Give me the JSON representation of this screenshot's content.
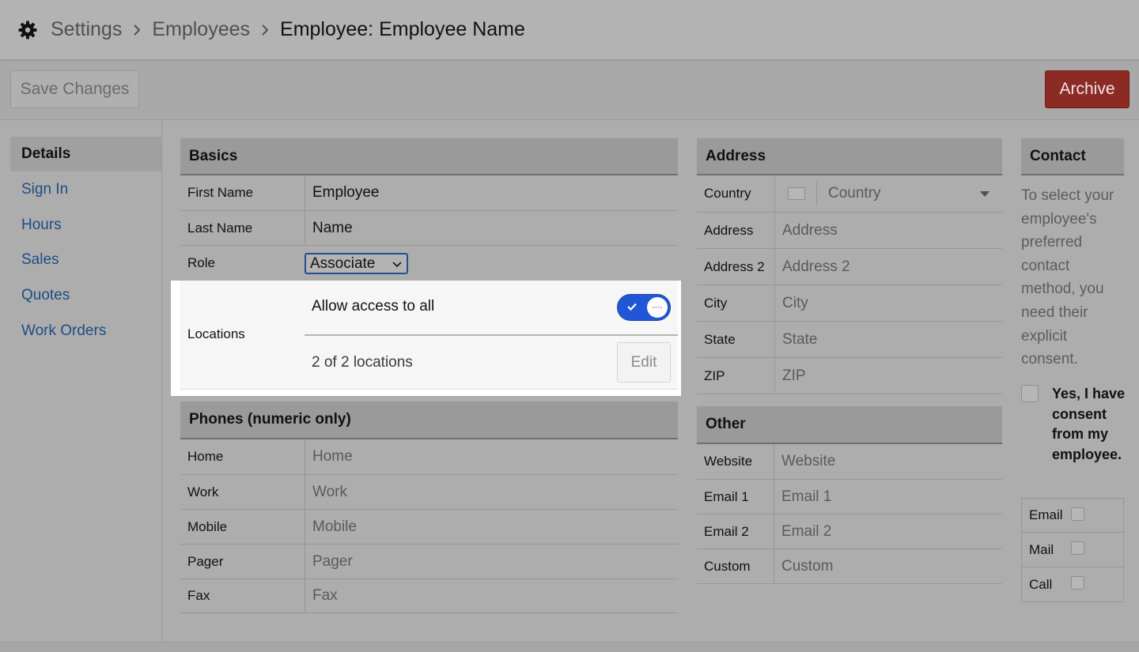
{
  "breadcrumb": {
    "items": [
      "Settings",
      "Employees"
    ],
    "current": "Employee: Employee Name",
    "icon": "gear-icon"
  },
  "toolbar": {
    "save_label": "Save Changes",
    "archive_label": "Archive",
    "archive_color": "#8c2a24"
  },
  "sidebar": {
    "items": [
      {
        "label": "Details",
        "active": true
      },
      {
        "label": "Sign In"
      },
      {
        "label": "Hours"
      },
      {
        "label": "Sales"
      },
      {
        "label": "Quotes"
      },
      {
        "label": "Work Orders"
      }
    ],
    "link_color": "#1d4d86"
  },
  "basics": {
    "title": "Basics",
    "first_name_label": "First Name",
    "first_name_value": "Employee",
    "last_name_label": "Last Name",
    "last_name_value": "Name",
    "role_label": "Role",
    "role_value": "Associate",
    "locations_label": "Locations",
    "allow_all_label": "Allow access to all",
    "allow_all_on": true,
    "locations_count": "2 of 2 locations",
    "edit_label": "Edit",
    "toggle_color": "#2157d6"
  },
  "phones": {
    "title": "Phones (numeric only)",
    "fields": [
      {
        "label": "Home",
        "placeholder": "Home"
      },
      {
        "label": "Work",
        "placeholder": "Work"
      },
      {
        "label": "Mobile",
        "placeholder": "Mobile"
      },
      {
        "label": "Pager",
        "placeholder": "Pager"
      },
      {
        "label": "Fax",
        "placeholder": "Fax"
      }
    ]
  },
  "address": {
    "title": "Address",
    "country_label": "Country",
    "country_placeholder": "Country",
    "fields": [
      {
        "label": "Address",
        "placeholder": "Address"
      },
      {
        "label": "Address 2",
        "placeholder": "Address 2"
      },
      {
        "label": "City",
        "placeholder": "City"
      },
      {
        "label": "State",
        "placeholder": "State"
      },
      {
        "label": "ZIP",
        "placeholder": "ZIP"
      }
    ]
  },
  "other": {
    "title": "Other",
    "fields": [
      {
        "label": "Website",
        "placeholder": "Website"
      },
      {
        "label": "Email 1",
        "placeholder": "Email 1"
      },
      {
        "label": "Email 2",
        "placeholder": "Email 2"
      },
      {
        "label": "Custom",
        "placeholder": "Custom"
      }
    ]
  },
  "contact": {
    "title": "Contact",
    "description": "To select your employee's preferred contact method, you need their explicit consent.",
    "consent_label": "Yes, I have consent from my employee.",
    "methods": [
      {
        "label": "Email"
      },
      {
        "label": "Mail"
      },
      {
        "label": "Call"
      }
    ]
  }
}
